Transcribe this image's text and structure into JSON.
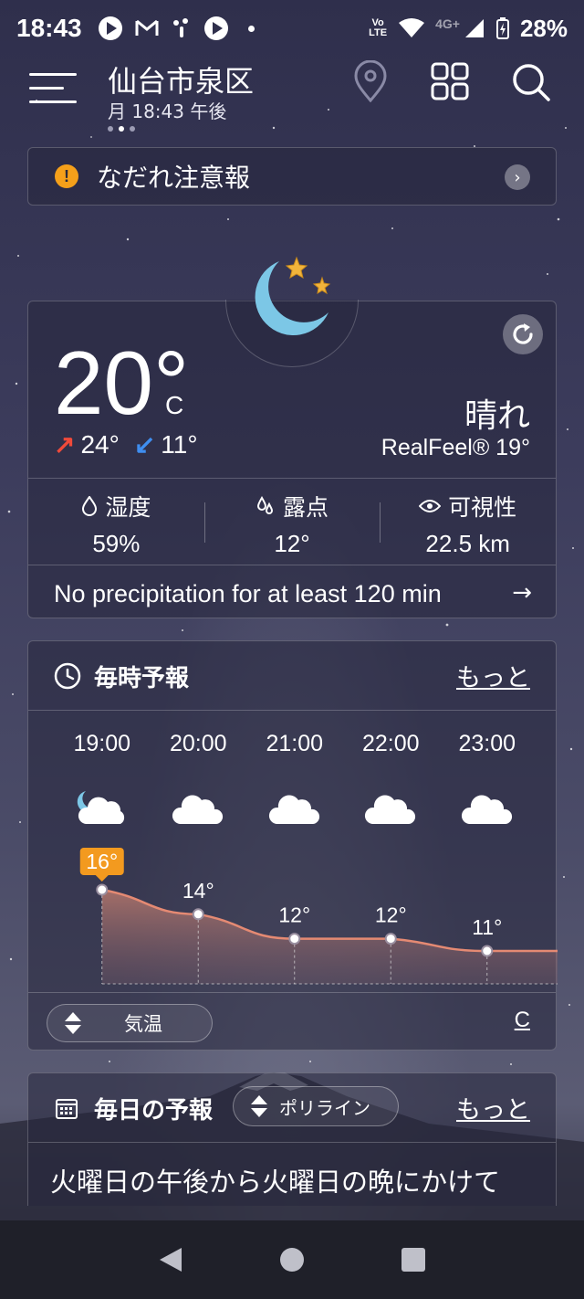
{
  "status_bar": {
    "time": "18:43",
    "notifications": [
      "play-icon",
      "gmail-icon",
      "beat-icon",
      "play-icon",
      "dot"
    ],
    "network": "4G+",
    "volte": "Vo LTE",
    "battery": "28%"
  },
  "header": {
    "location": "仙台市泉区",
    "local_time": "月 18:43 午後"
  },
  "alert": {
    "icon": "!",
    "text": "なだれ注意報"
  },
  "current": {
    "temperature": "20°",
    "unit": "C",
    "high": "24°",
    "low": "11°",
    "condition": "晴れ",
    "realfeel": "RealFeel® 19°",
    "humidity_label": "湿度",
    "humidity_value": "59%",
    "dewpoint_label": "露点",
    "dewpoint_value": "12°",
    "visibility_label": "可視性",
    "visibility_value": "22.5 km",
    "precipitation": "No precipitation for at least 120 min"
  },
  "hourly": {
    "title": "毎時予報",
    "more": "もっと",
    "hours": [
      "19:00",
      "20:00",
      "21:00",
      "22:00",
      "23:00"
    ],
    "icons": [
      "partly-cloudy-night-icon",
      "cloud-icon",
      "cloud-icon",
      "cloud-icon",
      "cloud-icon"
    ],
    "metric_toggle": "気温",
    "unit_link": "C"
  },
  "chart_data": {
    "type": "area",
    "x": [
      "19:00",
      "20:00",
      "21:00",
      "22:00",
      "23:00"
    ],
    "values": [
      16,
      14,
      12,
      12,
      11
    ],
    "labels": [
      "16°",
      "14°",
      "12°",
      "12°",
      "11°"
    ],
    "highlight_index": 0
  },
  "daily": {
    "title": "毎日の予報",
    "toggle": "ポリライン",
    "more": "もっと",
    "summary": "火曜日の午後から火曜日の晩にかけて"
  },
  "colors": {
    "alert_icon": "#f5a01a",
    "high_arrow": "#f04a3a",
    "low_arrow": "#3f8ef0",
    "highlight_label": "#f39a1f",
    "chart_line": "#e58a73",
    "moon": "#7cc7e6",
    "stars": "#f1b43b"
  }
}
